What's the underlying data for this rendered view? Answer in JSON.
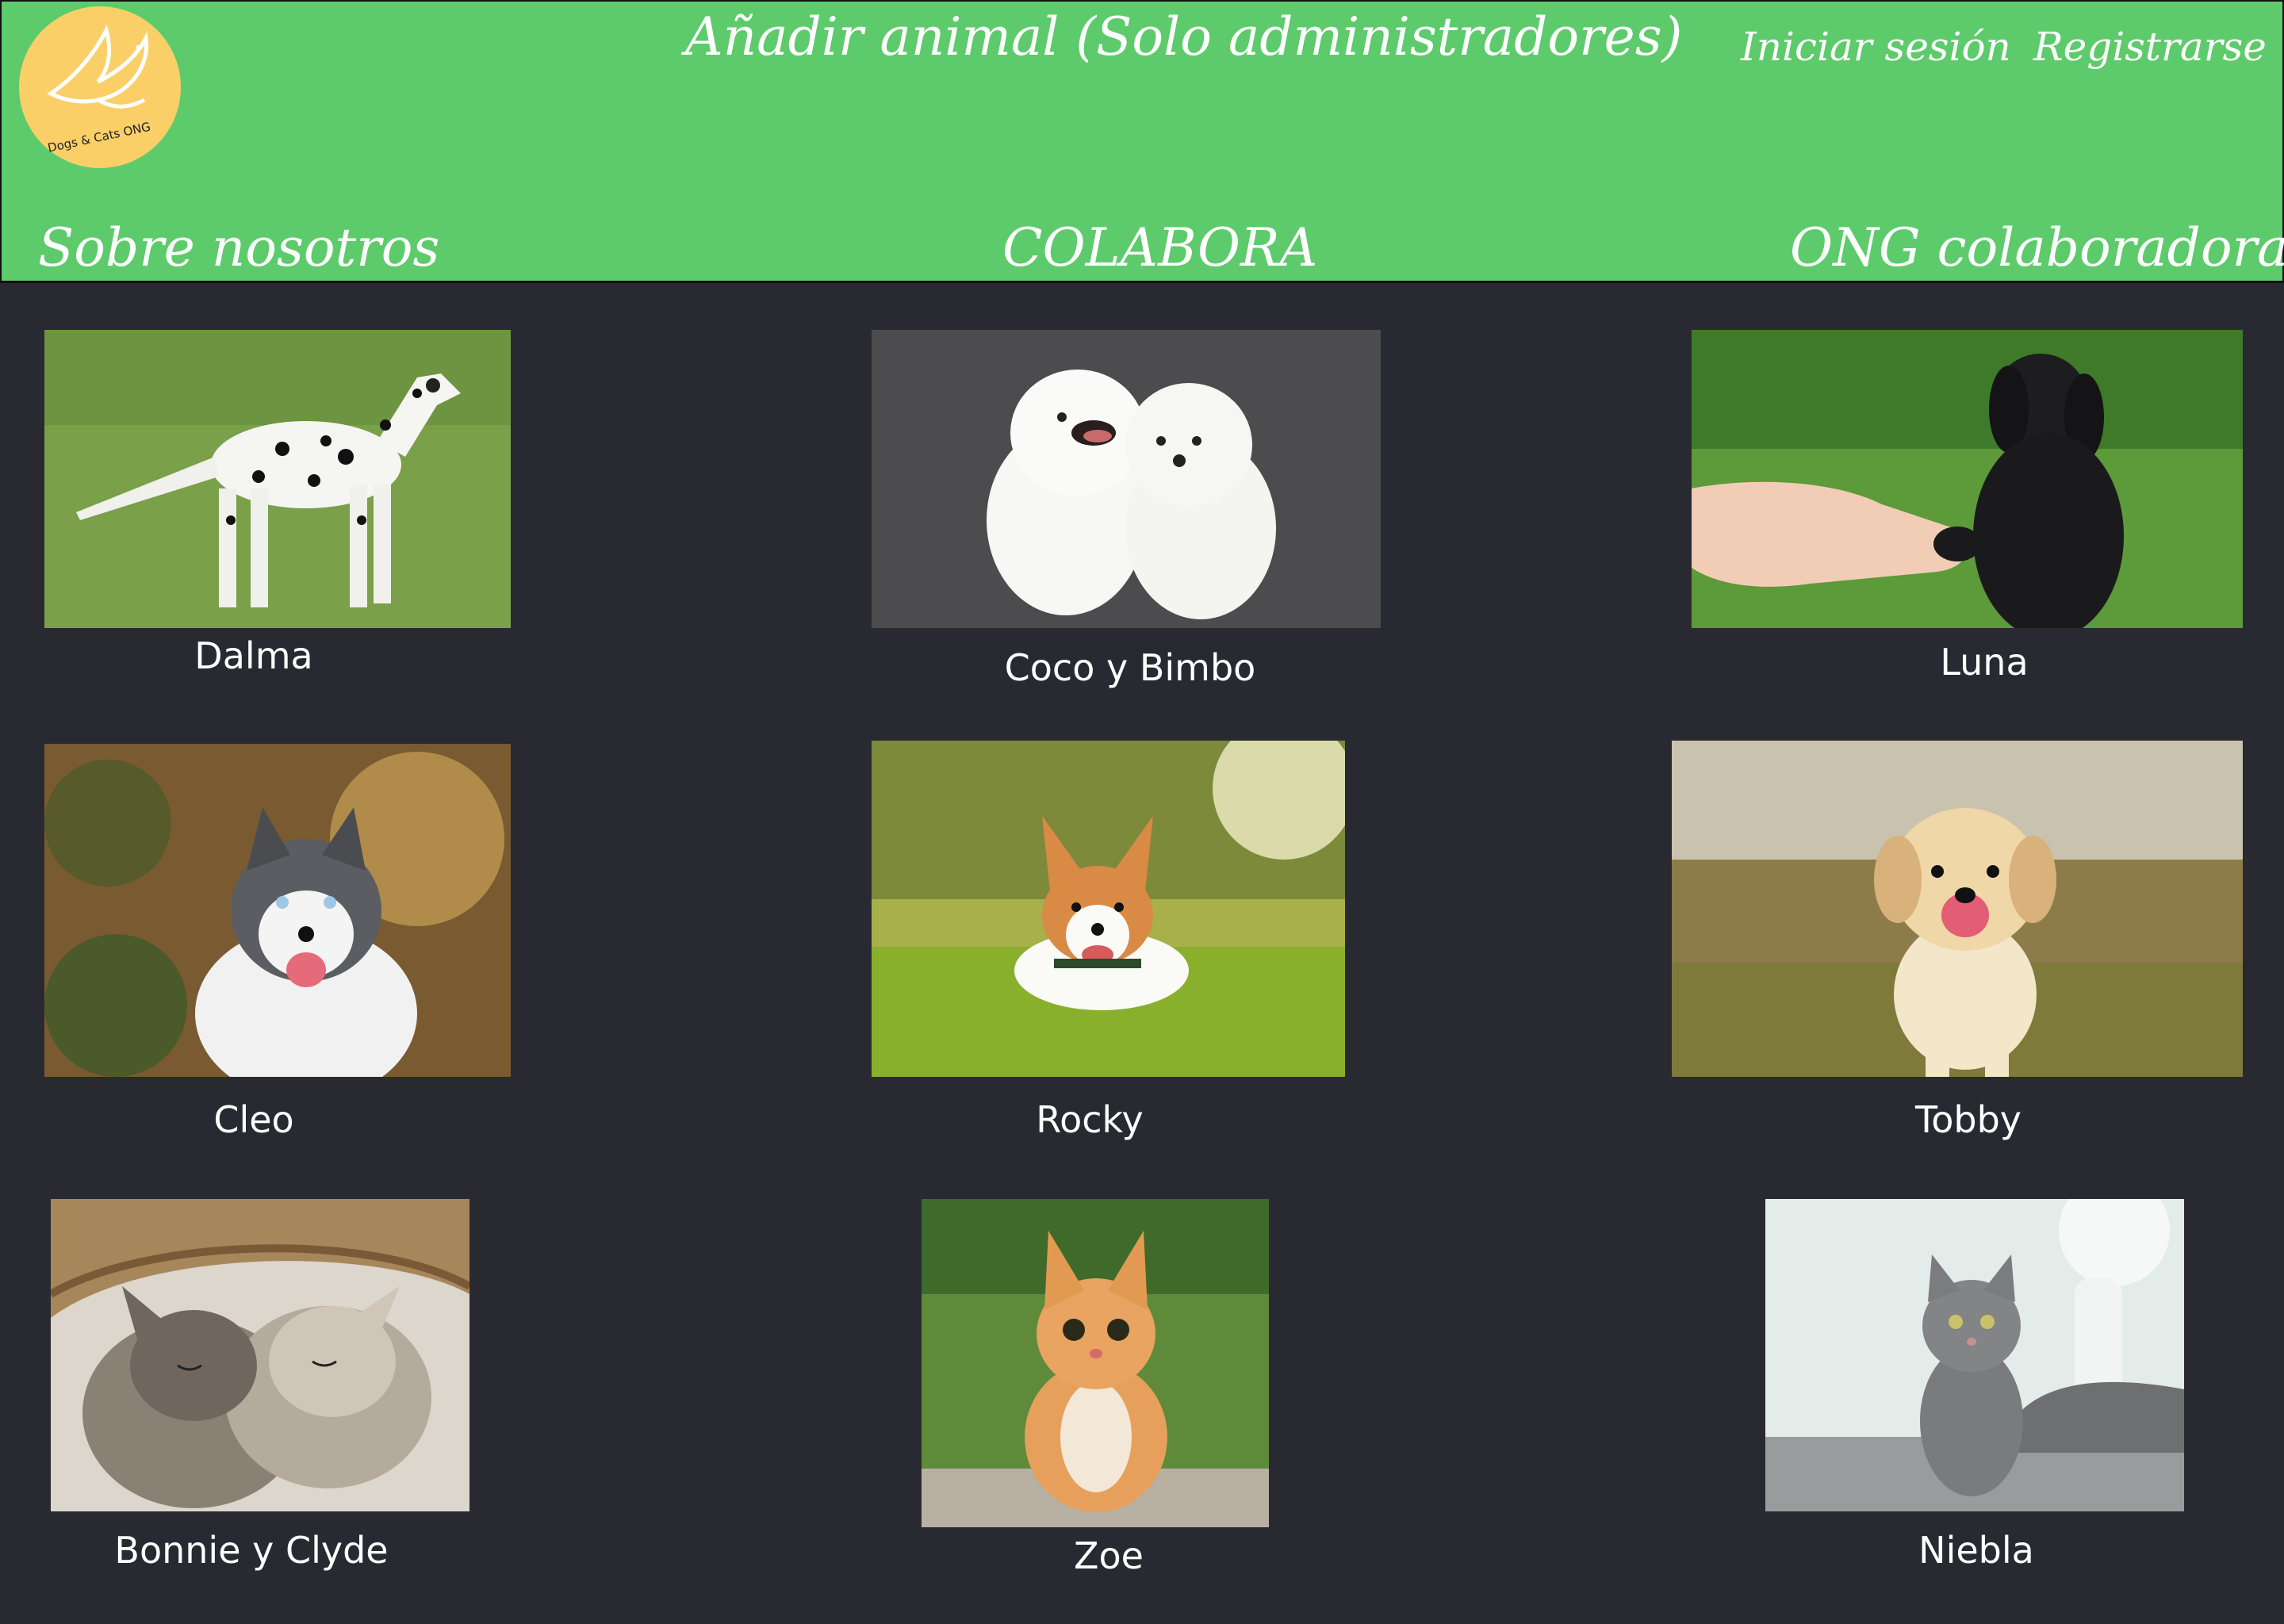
{
  "header": {
    "logo_text": "Dogs & Cats ONG",
    "add_animal": "Añadir animal (Solo administradores)",
    "login": "Iniciar sesión",
    "register": "Registrarse",
    "nav": [
      "Sobre nosotros",
      "COLABORA",
      "ONG colaboradoras"
    ]
  },
  "colors": {
    "header_bg": "#5dcb6b",
    "page_bg": "#292a31",
    "logo_bg": "#fbcf68"
  },
  "animals": [
    {
      "name": "Dalma",
      "photo": "dalmatian-photo"
    },
    {
      "name": "Coco y Bimbo",
      "photo": "white-puppies-photo"
    },
    {
      "name": "Luna",
      "photo": "black-puppy-photo"
    },
    {
      "name": "Cleo",
      "photo": "husky-photo"
    },
    {
      "name": "Rocky",
      "photo": "corgi-photo"
    },
    {
      "name": "Tobby",
      "photo": "golden-puppy-photo"
    },
    {
      "name": "Bonnie y Clyde",
      "photo": "kittens-basket-photo"
    },
    {
      "name": "Zoe",
      "photo": "orange-kitten-photo"
    },
    {
      "name": "Niebla",
      "photo": "grey-cat-photo"
    }
  ]
}
